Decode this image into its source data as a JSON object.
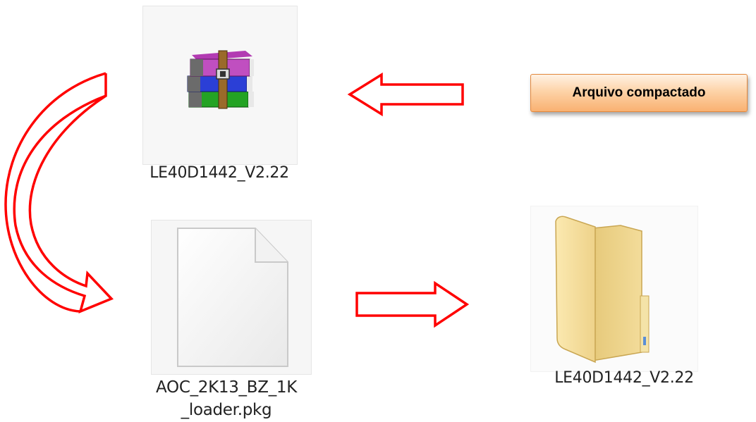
{
  "callout": {
    "text": "Arquivo compactado"
  },
  "files": {
    "archive": {
      "name": "LE40D1442_V2.22",
      "icon": "winrar-archive-icon"
    },
    "package": {
      "name_line1": "AOC_2K13_BZ_1K",
      "name_line2": "_loader.pkg",
      "icon": "generic-file-icon"
    },
    "folder": {
      "name": "LE40D1442_V2.22",
      "icon": "folder-icon"
    }
  },
  "colors": {
    "arrow": "#ff0000",
    "callout_border": "#e2873c",
    "callout_fill": "#fdd3a8"
  }
}
